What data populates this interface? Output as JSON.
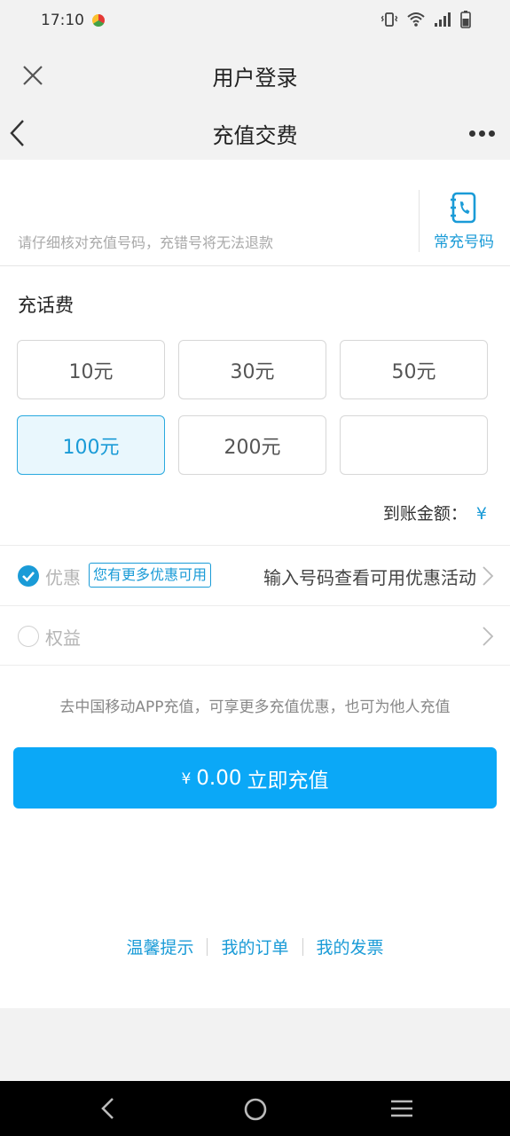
{
  "status_bar": {
    "time": "17:10"
  },
  "login_header": {
    "title": "用户登录"
  },
  "page_header": {
    "title": "充值交费"
  },
  "phone": {
    "hint": "请仔细核对充值号码，充错号将无法退款",
    "contacts_label": "常充号码"
  },
  "recharge": {
    "label": "充话费",
    "options": [
      {
        "label": "10元",
        "selected": false
      },
      {
        "label": "30元",
        "selected": false
      },
      {
        "label": "50元",
        "selected": false
      },
      {
        "label": "100元",
        "selected": true
      },
      {
        "label": "200元",
        "selected": false
      },
      {
        "label": "",
        "selected": false
      }
    ]
  },
  "arrival": {
    "label": "到账金额：",
    "currency": "¥"
  },
  "discount": {
    "label": "优惠",
    "badge": "您有更多优惠可用",
    "info": "输入号码查看可用优惠活动",
    "checked": true
  },
  "benefits": {
    "label": "权益",
    "checked": false
  },
  "promo_tip": "去中国移动APP充值，可享更多充值优惠，也可为他人充值",
  "pay_button": {
    "currency": "¥",
    "amount": "0.00",
    "label": "立即充值"
  },
  "footer": {
    "links": [
      "温馨提示",
      "我的订单",
      "我的发票"
    ]
  },
  "colors": {
    "accent": "#1a9bd7",
    "button": "#0ba8f7",
    "progress": "#1ab43e"
  }
}
